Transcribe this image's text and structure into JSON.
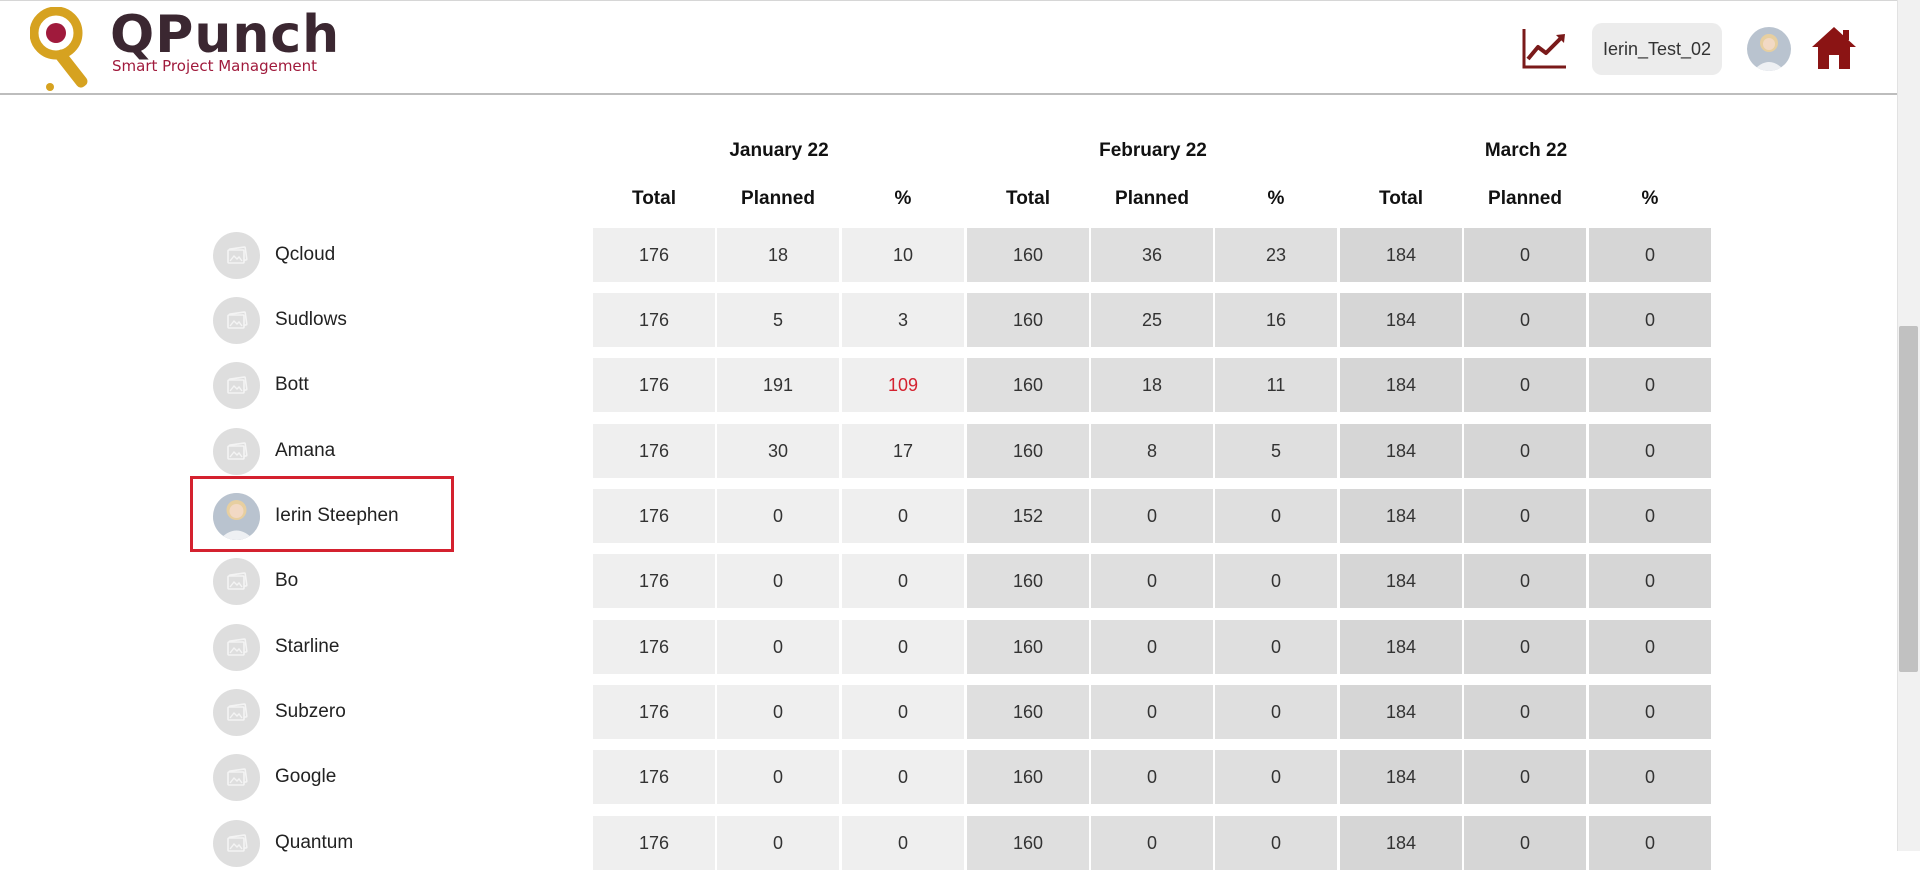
{
  "header": {
    "logo_name": "QPunch",
    "logo_tagline": "Smart Project Management",
    "user_label": "Ierin_Test_02",
    "brand_color": "#7a1a1a"
  },
  "months": [
    {
      "label": "January 22",
      "cols": [
        "Total",
        "Planned",
        "%"
      ]
    },
    {
      "label": "February 22",
      "cols": [
        "Total",
        "Planned",
        "%"
      ]
    },
    {
      "label": "March 22",
      "cols": [
        "Total",
        "Planned",
        "%"
      ]
    }
  ],
  "rows": [
    {
      "name": "Qcloud",
      "avatar": "placeholder-image-icon",
      "values": [
        "176",
        "18",
        "10",
        "160",
        "36",
        "23",
        "184",
        "0",
        "0"
      ]
    },
    {
      "name": "Sudlows",
      "avatar": "placeholder-image-icon",
      "values": [
        "176",
        "5",
        "3",
        "160",
        "25",
        "16",
        "184",
        "0",
        "0"
      ]
    },
    {
      "name": "Bott",
      "avatar": "placeholder-image-icon",
      "values": [
        "176",
        "191",
        "109",
        "160",
        "18",
        "11",
        "184",
        "0",
        "0"
      ],
      "over_index": 2
    },
    {
      "name": "Amana",
      "avatar": "placeholder-image-icon",
      "values": [
        "176",
        "30",
        "17",
        "160",
        "8",
        "5",
        "184",
        "0",
        "0"
      ]
    },
    {
      "name": "Ierin Steephen",
      "avatar": "user-photo",
      "values": [
        "176",
        "0",
        "0",
        "152",
        "0",
        "0",
        "184",
        "0",
        "0"
      ],
      "highlighted": true
    },
    {
      "name": "Bo",
      "avatar": "placeholder-image-icon",
      "values": [
        "176",
        "0",
        "0",
        "160",
        "0",
        "0",
        "184",
        "0",
        "0"
      ]
    },
    {
      "name": "Starline",
      "avatar": "placeholder-image-icon",
      "values": [
        "176",
        "0",
        "0",
        "160",
        "0",
        "0",
        "184",
        "0",
        "0"
      ]
    },
    {
      "name": "Subzero",
      "avatar": "placeholder-image-icon",
      "values": [
        "176",
        "0",
        "0",
        "160",
        "0",
        "0",
        "184",
        "0",
        "0"
      ]
    },
    {
      "name": "Google",
      "avatar": "placeholder-image-icon",
      "values": [
        "176",
        "0",
        "0",
        "160",
        "0",
        "0",
        "184",
        "0",
        "0"
      ]
    },
    {
      "name": "Quantum",
      "avatar": "placeholder-image-icon",
      "values": [
        "176",
        "0",
        "0",
        "160",
        "0",
        "0",
        "184",
        "0",
        "0"
      ]
    }
  ],
  "over_color": "#d4212f"
}
